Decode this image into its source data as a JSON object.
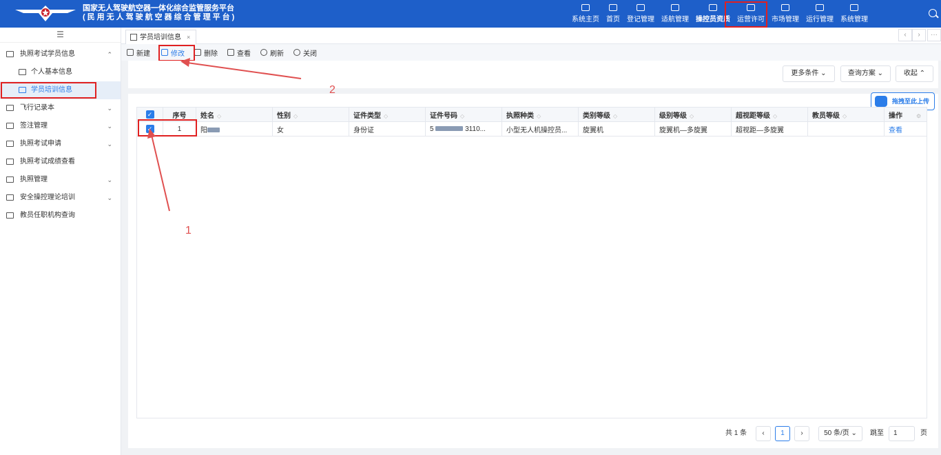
{
  "header": {
    "title_line1": "国家无人驾驶航空器一体化综合监管服务平台",
    "title_line2": "(民用无人驾驶航空器综合管理平台)",
    "nav": [
      "系统主页",
      "首页",
      "登记管理",
      "适航管理",
      "操控员资质",
      "运营许可",
      "市场管理",
      "运行管理",
      "系统管理"
    ],
    "active_nav": "操控员资质"
  },
  "sidebar": {
    "items": [
      {
        "label": "执照考试学员信息",
        "expanded": true
      },
      {
        "label": "个人基本信息"
      },
      {
        "label": "学员培训信息",
        "selected": true
      },
      {
        "label": "飞行记录本"
      },
      {
        "label": "签注管理"
      },
      {
        "label": "执照考试申请"
      },
      {
        "label": "执照考试成绩查看"
      },
      {
        "label": "执照管理"
      },
      {
        "label": "安全操控理论培训"
      },
      {
        "label": "教员任职机构查询"
      }
    ]
  },
  "tab": {
    "label": "学员培训信息",
    "close": "×"
  },
  "tabctrl": {
    "prev": "‹",
    "next": "›",
    "more": "···"
  },
  "toolbar": {
    "new": "新建",
    "edit": "修改",
    "delete": "删除",
    "view": "查看",
    "refresh": "刷新",
    "close": "关闭"
  },
  "filters": {
    "more": "更多条件 ⌄",
    "scheme": "查询方案 ⌄",
    "collapse": "收起 ⌃"
  },
  "upload": {
    "label": "拖拽至此上传"
  },
  "table": {
    "columns": [
      "序号",
      "姓名",
      "性别",
      "证件类型",
      "证件号码",
      "执照种类",
      "类别等级",
      "级别等级",
      "超视距等级",
      "教员等级",
      "操作"
    ],
    "rows": [
      {
        "index": "1",
        "name": "阳",
        "gender": "女",
        "id_type": "身份证",
        "id_number": "5",
        "id_suffix": "3110...",
        "license": "小型无人机操控员...",
        "category": "旋翼机",
        "level": "旋翼机—多旋翼",
        "bvlos": "超视距—多旋翼",
        "instructor": "",
        "action": "查看"
      }
    ]
  },
  "pagination": {
    "total": "共 1 条",
    "current": "1",
    "page_size": "50 条/页 ⌄",
    "jump_label": "跳至",
    "jump_value": "1",
    "page_unit": "页"
  },
  "annotations": {
    "label1": "1",
    "label2": "2"
  },
  "colors": {
    "header": "#1e5fc9",
    "accent": "#2b7de9",
    "annotation": "#e02020"
  }
}
